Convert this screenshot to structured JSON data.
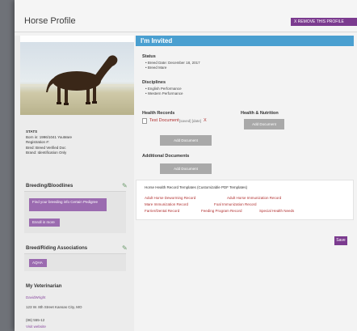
{
  "header": {
    "title": "Horse Profile",
    "remove_button": "X REMOVE THIS PROFILE"
  },
  "sidebar": {
    "stats": [
      "STATS",
      "Born in: 1996/1041 YouMare",
      "Registration #:",
      "Bred: Breed Verified Doc",
      "Brand: Identification Only"
    ],
    "breeding": {
      "title": "Breeding/Bloodlines",
      "btn1": "Find your breeding info Certain Pedigree",
      "btn2": "Enroll in more"
    },
    "associations": {
      "title": "Breed/Riding Associations",
      "badge": "AQHA"
    },
    "vet": {
      "title": "My Veterinarian",
      "lines": [
        "DavidWright",
        "123 W. 8th Street Kansas City, MO",
        "(86) 555-12",
        "Visit website"
      ]
    }
  },
  "main": {
    "banner": "I'm Invited",
    "status_label": "Status",
    "status_items": [
      "Breed Date: December 18, 2017",
      "Breed Mare"
    ],
    "disciplines_label": "Disciplines",
    "disciplines_items": [
      "English Performance",
      "Western Performance"
    ],
    "health_records_label": "Health Records",
    "test_doc": "Test Document",
    "test_doc_meta": "[saved] [date]",
    "delete_mark": "X",
    "add_document": "Add Document",
    "health_nutrition_label": "Health & Nutrition",
    "health_nutrition_btn": "Add Document",
    "additional_docs_label": "Additional Documents",
    "additional_btn": "Add Document",
    "template": {
      "title": "Horse Health Record Templates (Customizable PDF Templates)",
      "links": [
        "Adult Horse Deworming Record",
        "Adult Horse Immunization Record",
        "Mare Immunization Record",
        "Foal Immunization Record",
        "Farrier/Dental Record",
        "Feeding Program Record",
        "Special Health Needs"
      ]
    },
    "save": "Save"
  }
}
